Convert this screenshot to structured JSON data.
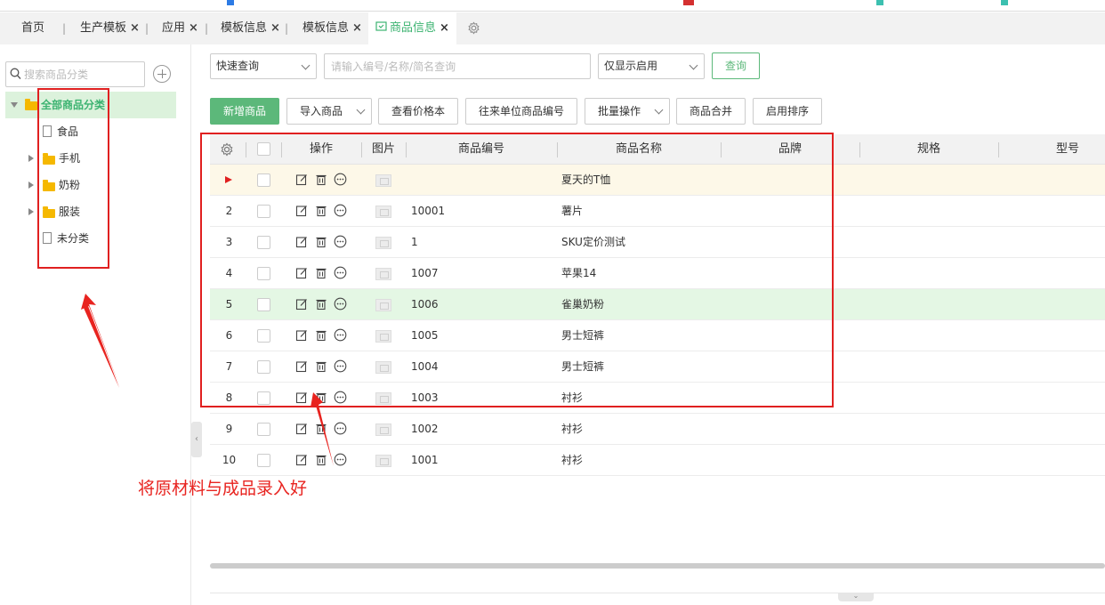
{
  "tabs": [
    {
      "label": "首页",
      "closable": false
    },
    {
      "label": "生产模板",
      "closable": true
    },
    {
      "label": "应用",
      "closable": true
    },
    {
      "label": "模板信息",
      "closable": true
    },
    {
      "label": "模板信息",
      "closable": true
    },
    {
      "label": "商品信息",
      "closable": true,
      "active": true
    }
  ],
  "tab_close_glyph": "×",
  "sidebar": {
    "search_placeholder": "搜索商品分类",
    "root": "全部商品分类",
    "items": [
      {
        "label": "食品",
        "type": "file"
      },
      {
        "label": "手机",
        "type": "folder"
      },
      {
        "label": "奶粉",
        "type": "folder"
      },
      {
        "label": "服装",
        "type": "folder"
      },
      {
        "label": "未分类",
        "type": "file"
      }
    ]
  },
  "filters": {
    "query_type": "快速查询",
    "keyword_placeholder": "请输入编号/名称/简名查询",
    "status": "仅显示启用",
    "query_button": "查询"
  },
  "toolbar": {
    "add": "新增商品",
    "import": "导入商品",
    "price_book": "查看价格本",
    "partner_code": "往来单位商品编号",
    "batch": "批量操作",
    "merge": "商品合并",
    "sort": "启用排序"
  },
  "table": {
    "columns": {
      "ops": "操作",
      "image": "图片",
      "code": "商品编号",
      "name": "商品名称",
      "brand": "品牌",
      "spec": "规格",
      "model": "型号"
    },
    "rows": [
      {
        "index": "",
        "code": "",
        "name": "夏天的T恤",
        "current": true
      },
      {
        "index": "2",
        "code": "10001",
        "name": "薯片"
      },
      {
        "index": "3",
        "code": "1",
        "name": "SKU定价测试"
      },
      {
        "index": "4",
        "code": "1007",
        "name": "苹果14"
      },
      {
        "index": "5",
        "code": "1006",
        "name": "雀巢奶粉",
        "selected": true
      },
      {
        "index": "6",
        "code": "1005",
        "name": "男士短裤"
      },
      {
        "index": "7",
        "code": "1004",
        "name": "男士短裤"
      },
      {
        "index": "8",
        "code": "1003",
        "name": "衬衫"
      },
      {
        "index": "9",
        "code": "1002",
        "name": "衬衫"
      },
      {
        "index": "10",
        "code": "1001",
        "name": "衬衫"
      }
    ]
  },
  "annotation": {
    "text": "将原材料与成品录入好",
    "color": "#e8231f"
  },
  "colors": {
    "accent": "#5cb87a",
    "selected_row": "#e4f7e4",
    "current_row": "#fdf8e8",
    "annotation_red": "#e02020"
  }
}
